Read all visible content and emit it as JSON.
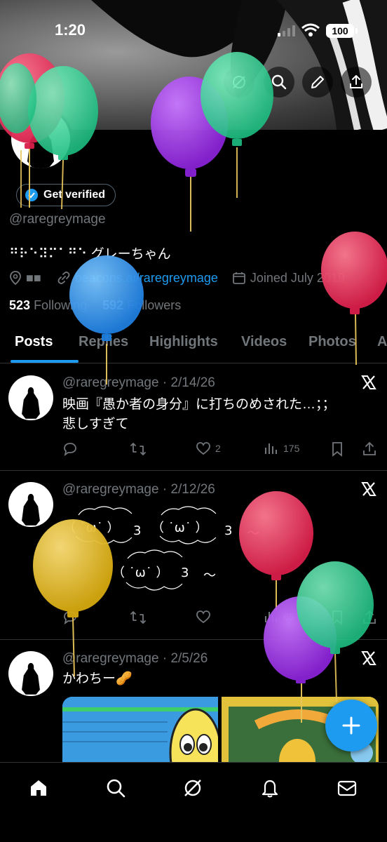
{
  "status": {
    "time": "1:20",
    "battery": "100",
    "signal_icon": "cellular-signal-icon",
    "wifi_icon": "wifi-icon"
  },
  "header_actions": [
    "grok-icon",
    "search-icon",
    "edit-icon",
    "share-icon"
  ],
  "profile": {
    "verify_label": "Get verified",
    "handle": "@raregreymage",
    "bio": "⠛⠗⠑⠽⠍⠁⠛⠑ グレーちゃん",
    "location": "■■",
    "link": "beacons.ai/raregreymage",
    "joined": "Joined July 2019",
    "following_count": "523",
    "following_label": "Following",
    "followers_count": "592",
    "followers_label": "Followers"
  },
  "tabs": [
    "Posts",
    "Replies",
    "Highlights",
    "Videos",
    "Photos",
    "A"
  ],
  "posts": [
    {
      "header": "@raregreymage · 2/14/26",
      "text": "映画『愚か者の身分』に打ちのめされた…；；\n悲しすぎて",
      "likes": "2",
      "views": "175"
    },
    {
      "header": "@raregreymage · 2/12/26",
      "kaomoji": {
        "face1": "（ ˙ω˙ ）",
        "num1": "3",
        "face2": "（ ˙ω˙ ）",
        "num2": "3",
        "tilde1": "〜",
        "face3": "（ ˙ω˙ ）",
        "num3": "3",
        "tilde2": "〜"
      },
      "views": "65"
    },
    {
      "header": "@raregreymage · 2/5/26",
      "text": "かわちー🥜"
    }
  ],
  "bottom_nav": [
    "home-icon",
    "search-icon",
    "grok-icon",
    "notifications-icon",
    "messages-icon"
  ],
  "fab_icon": "plus-icon",
  "colors": {
    "accent": "#1d9bf0",
    "background": "#000000",
    "secondary_text": "#71767b"
  }
}
